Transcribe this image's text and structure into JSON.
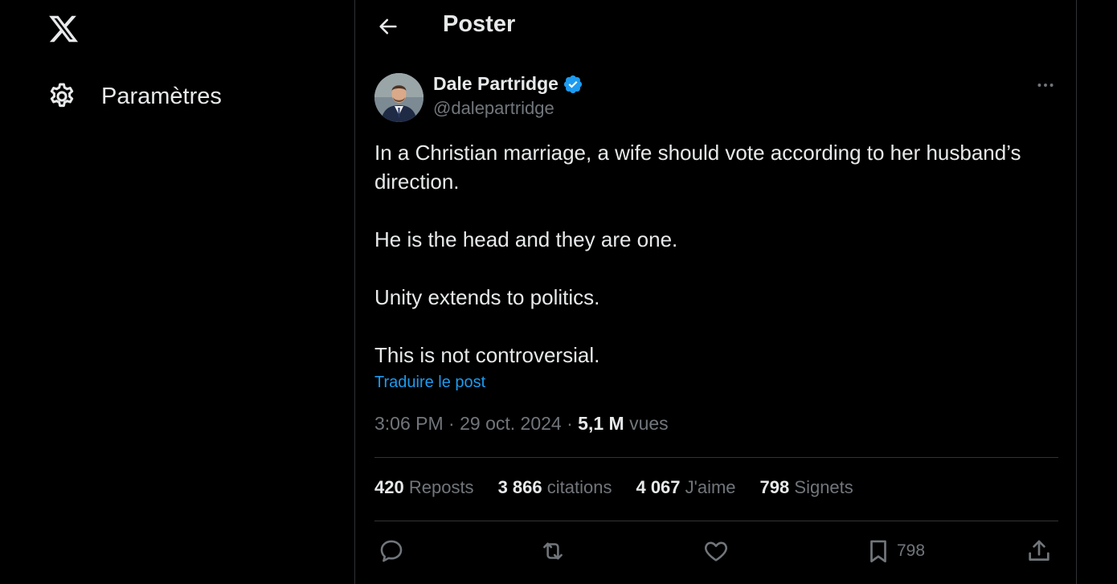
{
  "sidebar": {
    "logo_icon": "x-logo-icon",
    "settings": {
      "icon": "gear-icon",
      "label": "Paramètres"
    }
  },
  "header": {
    "back_icon": "arrow-left-icon",
    "title": "Poster"
  },
  "post": {
    "author": {
      "name": "Dale Partridge",
      "handle": "@dalepartridge",
      "verified": true,
      "verified_color": "#1d9bf0"
    },
    "paragraphs": [
      "In a Christian marriage, a wife should vote according to her husband’s direction.",
      "He is the head and they are one.",
      "Unity extends to politics.",
      "This is not controversial."
    ],
    "translate_label": "Traduire le post",
    "time": "3:06 PM",
    "date": "29 oct. 2024",
    "views_count": "5,1 M",
    "views_label": "vues"
  },
  "stats": {
    "reposts": {
      "count": "420",
      "label": "Reposts"
    },
    "quotes": {
      "count": "3 866",
      "label": "citations"
    },
    "likes": {
      "count": "4 067",
      "label": "J'aime"
    },
    "bookmarks": {
      "count": "798",
      "label": "Signets"
    }
  },
  "actions": {
    "reply_icon": "reply-icon",
    "repost_icon": "repost-icon",
    "like_icon": "heart-icon",
    "bookmark_icon": "bookmark-icon",
    "bookmark_count": "798",
    "share_icon": "share-icon"
  },
  "colors": {
    "background": "#000000",
    "text": "#e7e9ea",
    "muted": "#71767b",
    "accent": "#1d9bf0",
    "border": "#2f3336"
  }
}
